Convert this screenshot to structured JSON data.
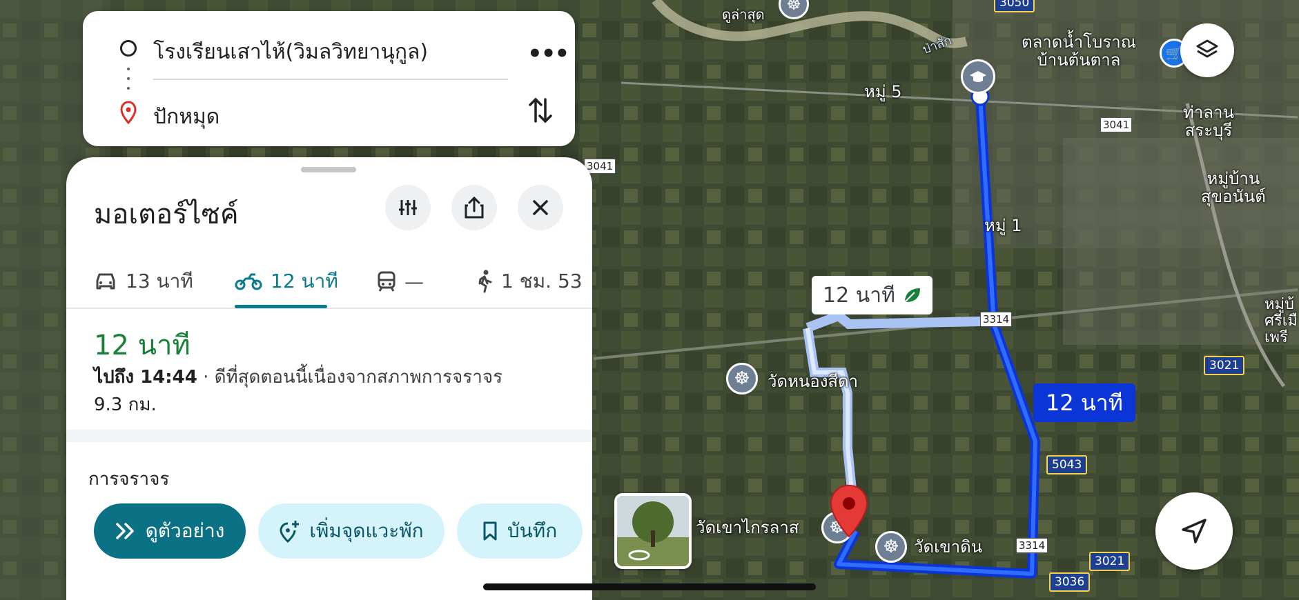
{
  "search": {
    "origin": "โรงเรียนเสาไห้(วิมลวิทยานุกูล)",
    "destination": "ปักหมุด"
  },
  "sheet": {
    "mode_title": "มอเตอร์ไซค์",
    "tabs": [
      {
        "icon": "car-icon",
        "label": "13 นาที"
      },
      {
        "icon": "motorcycle-icon",
        "label": "12 นาที",
        "active": true
      },
      {
        "icon": "transit-icon",
        "label": "—"
      },
      {
        "icon": "walk-icon",
        "label": "1 ชม. 53"
      }
    ],
    "route": {
      "duration": "12 นาที",
      "arrive_prefix": "ไปถึง 14:44",
      "arrive_note": " · ดีที่สุดตอนนี้เนื่องจากสภาพการจราจร",
      "distance": "9.3 กม."
    },
    "traffic_label": "การจราจร",
    "actions": {
      "preview": "ดูตัวอย่าง",
      "add_stop": "เพิ่มจุดแวะพัก",
      "save": "บันทึก"
    }
  },
  "map": {
    "callout_alt": "12 นาที",
    "callout_main": "12 นาที",
    "labels": {
      "market": "ตลาดน้ำโบราณ\nบ้านต้นตาล",
      "moo5": "หมู่ 5",
      "moo1": "หมู่ 1",
      "thalan": "ท่าลาน\nสระบุรี",
      "sukhonan": "หมู่บ้าน\nสุขอนันต์",
      "wat_nongsida": "วัดหนองสีดา",
      "wat_khaokailas": "วัดเขาไกรลาส",
      "wat_khaodin": "วัดเขาดิน",
      "seeall": "ดูล่าสุด",
      "pasak": "ป่าสัก",
      "moo_right": "หมู่บ้\nศรีเมื\nเพรี"
    },
    "road_signs": [
      "3041",
      "3041",
      "3314",
      "3314"
    ],
    "hwy_signs": [
      "3050",
      "3021",
      "5043",
      "3021",
      "3036"
    ]
  },
  "colors": {
    "accent": "#0b7285",
    "route_main": "#0b35d6",
    "route_alt": "#a9c3f5",
    "duration_green": "#188038"
  }
}
